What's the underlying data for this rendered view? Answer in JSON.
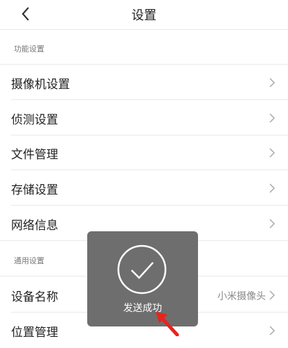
{
  "header": {
    "title": "设置",
    "back_icon": "chevron-left-icon"
  },
  "sections": [
    {
      "title": "功能设置",
      "items": [
        {
          "label": "摄像机设置"
        },
        {
          "label": "侦测设置"
        },
        {
          "label": "文件管理"
        },
        {
          "label": "存储设置"
        },
        {
          "label": "网络信息"
        }
      ]
    },
    {
      "title": "通用设置",
      "items": [
        {
          "label": "设备名称",
          "value": "小米摄像头"
        },
        {
          "label": "位置管理"
        }
      ]
    }
  ],
  "toast": {
    "message": "发送成功",
    "icon": "checkmark-circle-icon"
  },
  "colors": {
    "toast_bg": "#6e6e6e",
    "annotation_arrow": "#e8231c",
    "divider": "#e9e9e9"
  }
}
